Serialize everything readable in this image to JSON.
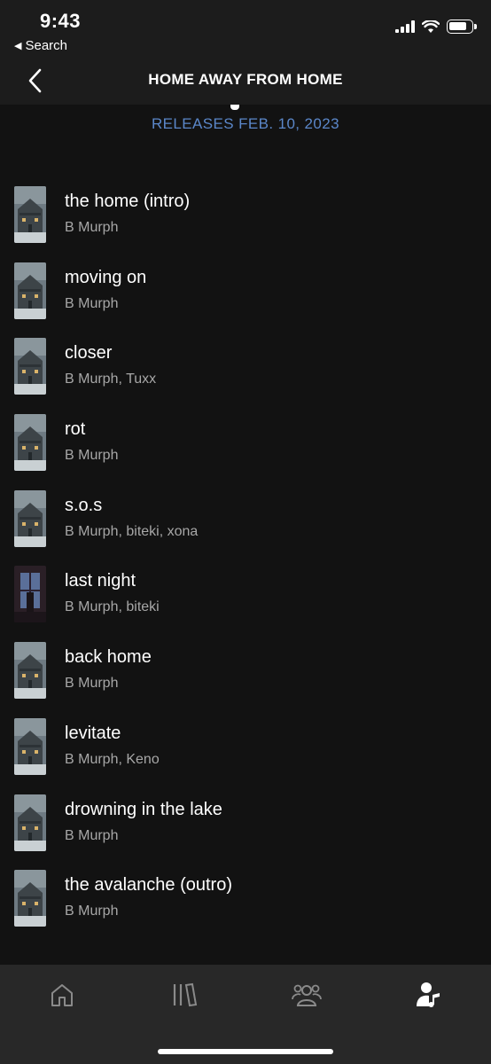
{
  "status_bar": {
    "time": "9:43",
    "back_app_label": "Search"
  },
  "header": {
    "title": "HOME AWAY FROM HOME"
  },
  "release_date": "RELEASES FEB. 10, 2023",
  "tracks": [
    {
      "title": "the home (intro)",
      "artist": "B Murph",
      "cover": "house-cover"
    },
    {
      "title": "moving on",
      "artist": "B Murph",
      "cover": "house-cover"
    },
    {
      "title": "closer",
      "artist": "B Murph, Tuxx",
      "cover": "house-cover"
    },
    {
      "title": "rot",
      "artist": "B Murph",
      "cover": "house-cover"
    },
    {
      "title": "s.o.s",
      "artist": "B Murph, biteki, xona",
      "cover": "house-cover"
    },
    {
      "title": "last night",
      "artist": "B Murph, biteki",
      "cover": "window-cover"
    },
    {
      "title": "back home",
      "artist": "B Murph",
      "cover": "house-cover"
    },
    {
      "title": "levitate",
      "artist": "B Murph, Keno",
      "cover": "house-cover"
    },
    {
      "title": "drowning in the lake",
      "artist": "B Murph",
      "cover": "house-cover"
    },
    {
      "title": "the avalanche (outro)",
      "artist": "B Murph",
      "cover": "house-cover"
    }
  ],
  "tabbar": {
    "items": [
      {
        "icon": "home-icon",
        "active": false
      },
      {
        "icon": "library-icon",
        "active": false
      },
      {
        "icon": "friends-icon",
        "active": false
      },
      {
        "icon": "artist-icon",
        "active": true
      }
    ]
  },
  "colors": {
    "background": "#121212",
    "header_bg": "#1c1c1c",
    "accent_blue": "#5b87c9",
    "secondary_text": "#a7a7a7",
    "tabbar_bg": "#282828"
  }
}
